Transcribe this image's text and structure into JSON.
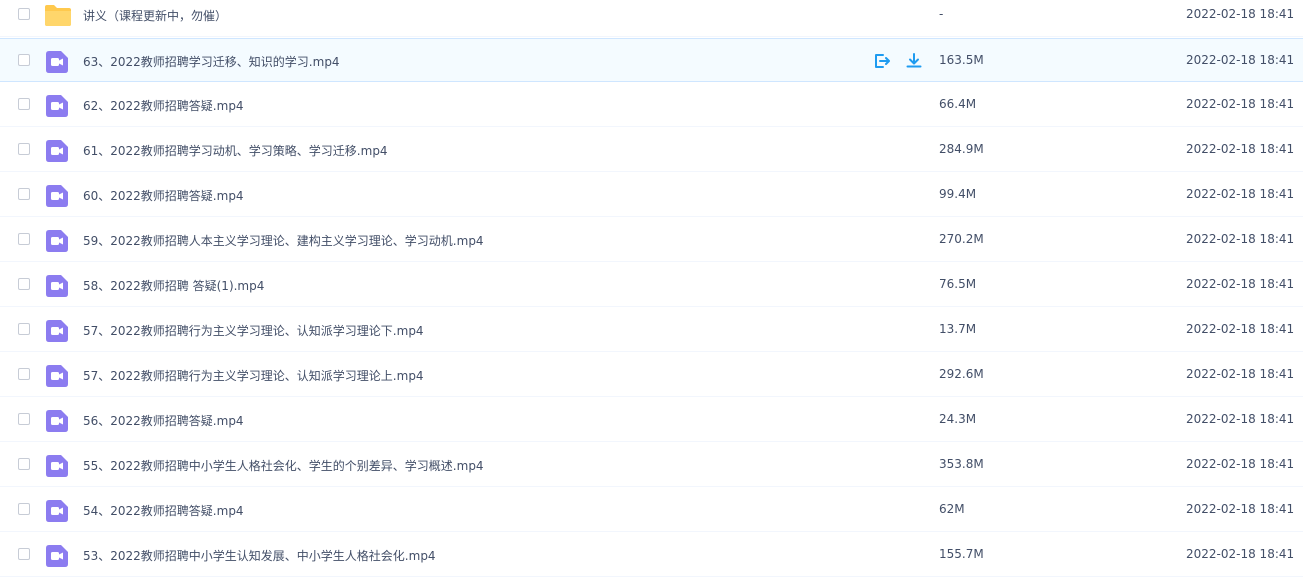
{
  "rows": [
    {
      "type": "folder",
      "name": "讲义（课程更新中，勿催）",
      "size": "-",
      "time": "2022-02-18 18:41"
    },
    {
      "type": "video",
      "name": "63、2022教师招聘学习迁移、知识的学习.mp4",
      "size": "163.5M",
      "time": "2022-02-18 18:41",
      "hover": true
    },
    {
      "type": "video",
      "name": "62、2022教师招聘答疑.mp4",
      "size": "66.4M",
      "time": "2022-02-18 18:41"
    },
    {
      "type": "video",
      "name": "61、2022教师招聘学习动机、学习策略、学习迁移.mp4",
      "size": "284.9M",
      "time": "2022-02-18 18:41"
    },
    {
      "type": "video",
      "name": "60、2022教师招聘答疑.mp4",
      "size": "99.4M",
      "time": "2022-02-18 18:41"
    },
    {
      "type": "video",
      "name": "59、2022教师招聘人本主义学习理论、建构主义学习理论、学习动机.mp4",
      "size": "270.2M",
      "time": "2022-02-18 18:41"
    },
    {
      "type": "video",
      "name": "58、2022教师招聘 答疑(1).mp4",
      "size": "76.5M",
      "time": "2022-02-18 18:41"
    },
    {
      "type": "video",
      "name": "57、2022教师招聘行为主义学习理论、认知派学习理论下.mp4",
      "size": "13.7M",
      "time": "2022-02-18 18:41"
    },
    {
      "type": "video",
      "name": "57、2022教师招聘行为主义学习理论、认知派学习理论上.mp4",
      "size": "292.6M",
      "time": "2022-02-18 18:41"
    },
    {
      "type": "video",
      "name": "56、2022教师招聘答疑.mp4",
      "size": "24.3M",
      "time": "2022-02-18 18:41"
    },
    {
      "type": "video",
      "name": "55、2022教师招聘中小学生人格社会化、学生的个别差异、学习概述.mp4",
      "size": "353.8M",
      "time": "2022-02-18 18:41"
    },
    {
      "type": "video",
      "name": "54、2022教师招聘答疑.mp4",
      "size": "62M",
      "time": "2022-02-18 18:41"
    },
    {
      "type": "video",
      "name": "53、2022教师招聘中小学生认知发展、中小学生人格社会化.mp4",
      "size": "155.7M",
      "time": "2022-02-18 18:41"
    }
  ],
  "colors": {
    "folder": "#ffc94d",
    "video": "#8c7cf0",
    "action": "#1e9bf0"
  }
}
